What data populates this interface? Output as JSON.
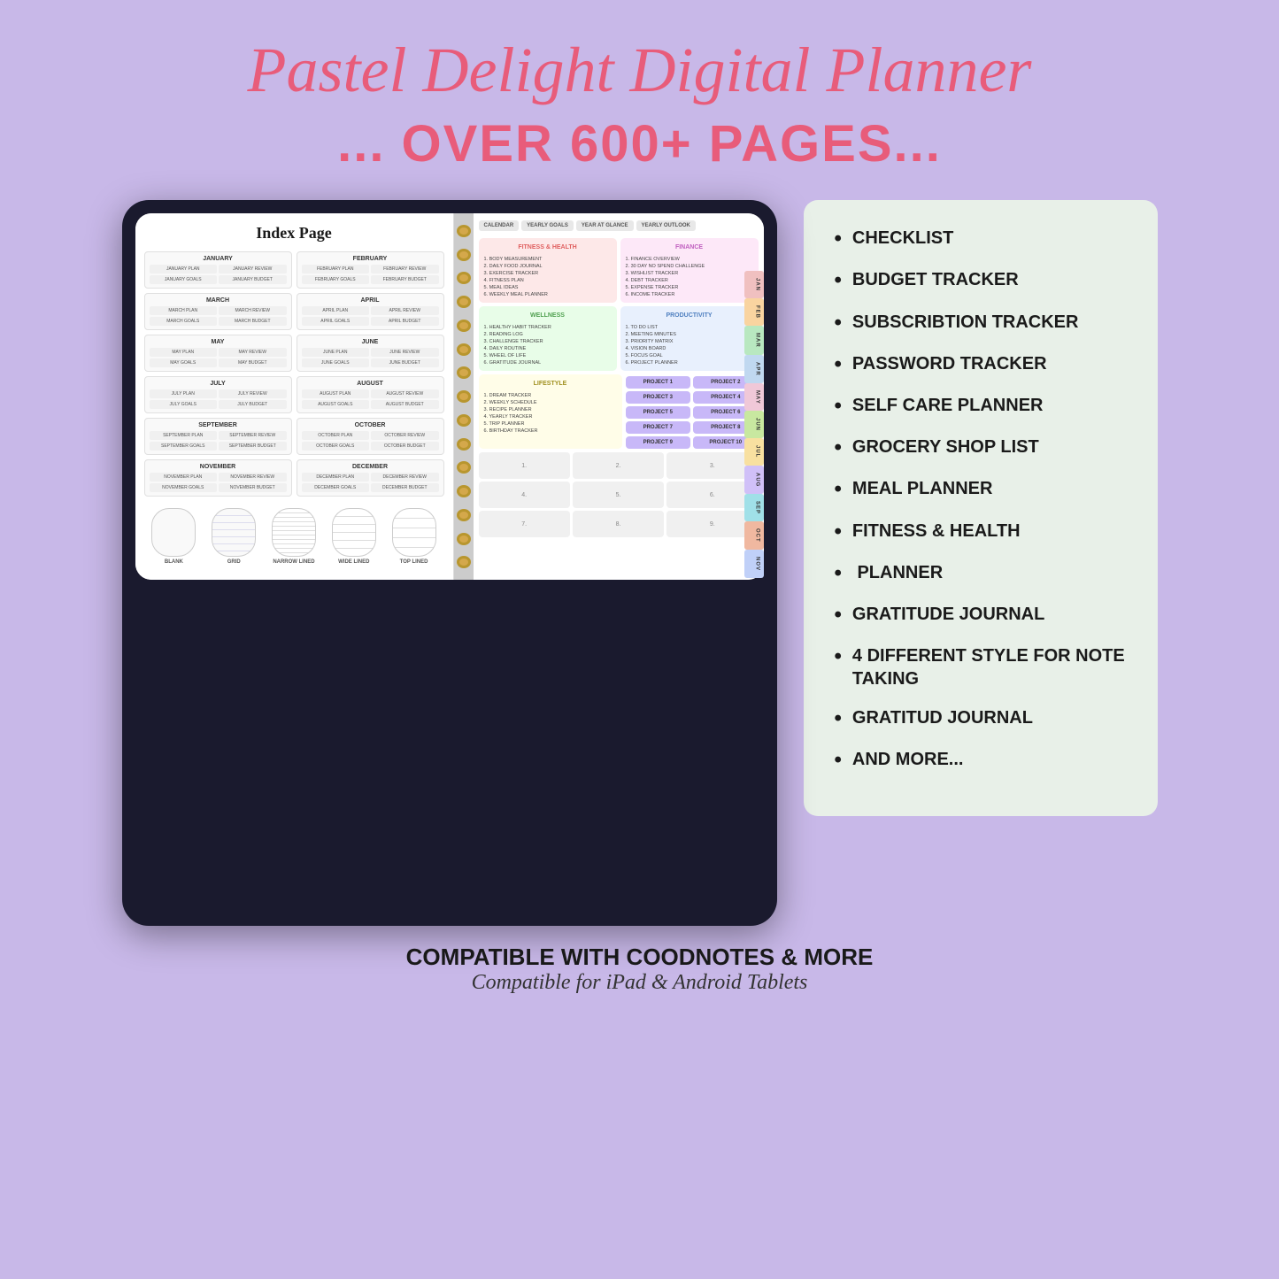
{
  "header": {
    "title": "Pastel Delight Digital Planner",
    "subtitle": "... OVER 600+ PAGES..."
  },
  "tablet": {
    "index_title": "Index Page",
    "months": [
      {
        "name": "JANUARY",
        "links": [
          "JANUARY PLAN",
          "JANUARY REVIEW",
          "JANUARY GOALS",
          "JANUARY BUDGET"
        ]
      },
      {
        "name": "FEBRUARY",
        "links": [
          "FEBRUARY PLAN",
          "FEBRUARY REVIEW",
          "FEBRUARY GOALS",
          "FEBRUARY BUDGET"
        ]
      },
      {
        "name": "MARCH",
        "links": [
          "MARCH PLAN",
          "MARCH REVIEW",
          "MARCH GOALS",
          "MARCH BUDGET"
        ]
      },
      {
        "name": "APRIL",
        "links": [
          "APRIL PLAN",
          "APRIL REVIEW",
          "APRIL GOALS",
          "APRIL BUDGET"
        ]
      },
      {
        "name": "MAY",
        "links": [
          "MAY PLAN",
          "MAY REVIEW",
          "MAY GOALS",
          "MAY BUDGET"
        ]
      },
      {
        "name": "JUNE",
        "links": [
          "JUNE PLAN",
          "JUNE REVIEW",
          "JUNE GOALS",
          "JUNE BUDGET"
        ]
      },
      {
        "name": "JULY",
        "links": [
          "JULY PLAN",
          "JULY REVIEW",
          "JULY GOALS",
          "JULY BUDGET"
        ]
      },
      {
        "name": "AUGUST",
        "links": [
          "AUGUST PLAN",
          "AUGUST REVIEW",
          "AUGUST GOALS",
          "AUGUST BUDGET"
        ]
      },
      {
        "name": "SEPTEMBER",
        "links": [
          "SEPTEMBER PLAN",
          "SEPTEMBER REVIEW",
          "SEPTEMBER GOALS",
          "SEPTEMBER BUDGET"
        ]
      },
      {
        "name": "OCTOBER",
        "links": [
          "OCTOBER PLAN",
          "OCTOBER REVIEW",
          "OCTOBER GOALS",
          "OCTOBER BUDGET"
        ]
      },
      {
        "name": "NOVEMBER",
        "links": [
          "NOVEMBER PLAN",
          "NOVEMBER REVIEW",
          "NOVEMBER GOALS",
          "NOVEMBER BUDGET"
        ]
      },
      {
        "name": "DECEMBER",
        "links": [
          "DECEMBER PLAN",
          "DECEMBER REVIEW",
          "DECEMBER GOALS",
          "DECEMBER BUDGET"
        ]
      }
    ],
    "note_styles": [
      "BLANK",
      "GRID",
      "NARROW LINED",
      "WIDE LINED",
      "TOP LINED"
    ],
    "tabs": [
      "CALENDAR",
      "YEARLY GOALS",
      "YEAR AT GLANCE",
      "YEARLY OUTLOOK"
    ],
    "side_tabs": [
      "JAN",
      "FEB",
      "MAR",
      "APR",
      "MAY",
      "JUN",
      "JUL",
      "AUG",
      "SEP",
      "OCT",
      "NOV"
    ],
    "categories": {
      "fitness": {
        "title": "FITNESS & HEALTH",
        "items": [
          "1. BODY MEASUREMENT",
          "2. DAILY FOOD JOURNAL",
          "3. EXERCISE TRACKER",
          "4. FITNESS PLAN",
          "5. MEAL IDEAS",
          "6. WEEKLY MEAL PLANNER"
        ]
      },
      "finance": {
        "title": "FINANCE",
        "items": [
          "1. FINANCE OVERVIEW",
          "2. 30 DAY NO SPEND CHALLENGE",
          "3. WISHLIST TRACKER",
          "4. DEBT TRACKER",
          "5. EXPENSE TRACKER",
          "6. INCOME TRACKER"
        ]
      },
      "wellness": {
        "title": "WELLNESS",
        "items": [
          "1. HEALTHY HABIT TRACKER",
          "2. READING LOG",
          "3. CHALLENGE TRACKER",
          "4. DAILY ROUTINE",
          "5. WHEEL OF LIFE",
          "6. GRATITUDE JOURNAL"
        ]
      },
      "productivity": {
        "title": "PRODUCTIVITY",
        "items": [
          "1. TO DO LIST",
          "2. MEETING MINUTES",
          "3. PRIORITY MATRIX",
          "4. VISION BOARD",
          "5. FOCUS GOAL",
          "6. PROJECT PLANNER"
        ]
      },
      "lifestyle": {
        "title": "LIFESTYLE",
        "items": [
          "1. DREAM TRACKER",
          "2. WEEKLY SCHEDULE",
          "3. RECIPE PLANNER",
          "4. YEARLY TRACKER",
          "5. TRIP PLANNER",
          "6. BIRTHDAY TRACKER"
        ]
      }
    },
    "projects": [
      "PROJECT 1",
      "PROJECT 2",
      "PROJECT 3",
      "PROJECT 4",
      "PROJECT 5",
      "PROJECT 6",
      "PROJECT 7",
      "PROJECT 8",
      "PROJECT 9",
      "PROJECT 10"
    ]
  },
  "bullet_list": {
    "items": [
      "CHECKLIST",
      "BUDGET TRACKER",
      "SUBSCRIBTION TRACKER",
      "PASSWORD TRACKER",
      "SELF CARE PLANNER",
      "GROCERY SHOP LIST",
      "MEAL PLANNER",
      "FITNESS & HEALTH",
      " PLANNER",
      "GRATITUDE JOURNAL",
      "4 DIFFERENT STYLE FOR NOTE TAKING",
      "GRATITUD JOURNAL",
      "AND MORE..."
    ]
  },
  "footer": {
    "main": "COMPATIBLE WITH COODNOTES & MORE",
    "sub": "Compatible for iPad & Android Tablets"
  }
}
